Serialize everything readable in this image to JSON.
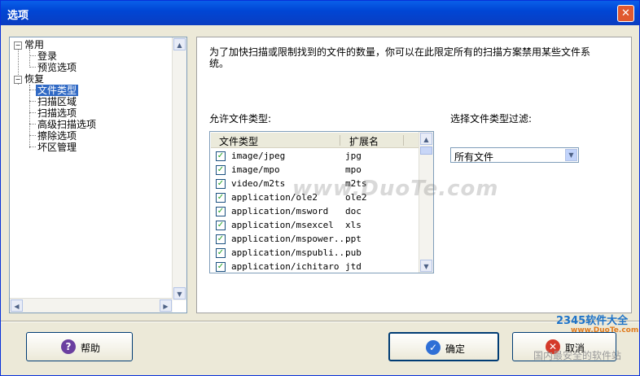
{
  "window": {
    "title": "选项",
    "close_glyph": "✕"
  },
  "tree": {
    "nodes": {
      "general": "常用",
      "login": "登录",
      "preview": "预览选项",
      "recover": "恢复",
      "file_types": "文件类型",
      "scan_area": "扫描区域",
      "scan_options": "扫描选项",
      "advanced_scan": "高级扫描选项",
      "erase_options": "擦除选项",
      "bad_sector": "坏区管理"
    }
  },
  "panel": {
    "description": "为了加快扫描或限制找到的文件的数量，你可以在此限定所有的扫描方案禁用某些文件系统。",
    "allowed_label": "允许文件类型:",
    "filter_label": "选择文件类型过滤:",
    "columns": [
      "文件类型",
      "扩展名"
    ],
    "rows": [
      {
        "type": "image/jpeg",
        "ext": "jpg",
        "checked": true
      },
      {
        "type": "image/mpo",
        "ext": "mpo",
        "checked": true
      },
      {
        "type": "video/m2ts",
        "ext": "m2ts",
        "checked": true
      },
      {
        "type": "application/ole2",
        "ext": "ole2",
        "checked": true
      },
      {
        "type": "application/msword",
        "ext": "doc",
        "checked": true
      },
      {
        "type": "application/msexcel",
        "ext": "xls",
        "checked": true
      },
      {
        "type": "application/mspower...",
        "ext": "ppt",
        "checked": true
      },
      {
        "type": "application/mspubli...",
        "ext": "pub",
        "checked": true
      },
      {
        "type": "application/ichitaro",
        "ext": "jtd",
        "checked": true
      }
    ],
    "filter_value": "所有文件"
  },
  "buttons": {
    "help": "帮助",
    "ok": "确定",
    "cancel": "取消"
  },
  "watermark": {
    "center": "www.DuoTe.com",
    "corner_brand": "2345软件大全",
    "corner_url": "www.DuoTe.com",
    "corner_site": "国内最安全的软件站"
  }
}
